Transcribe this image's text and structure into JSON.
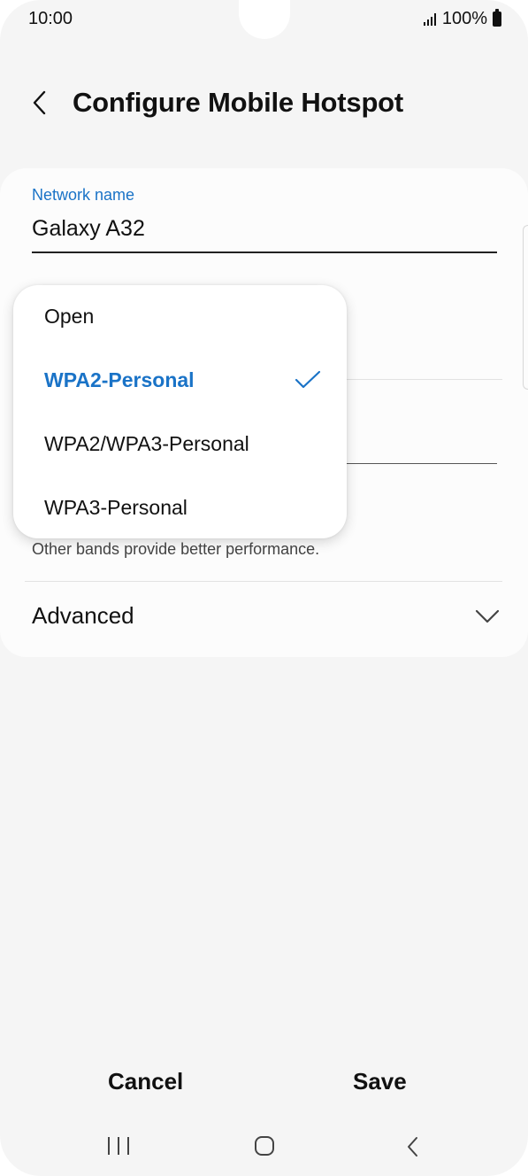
{
  "status_bar": {
    "time": "10:00",
    "battery": "100%",
    "icons": [
      "signal-icon",
      "battery-icon"
    ]
  },
  "header": {
    "title": "Configure Mobile Hotspot",
    "back_icon": "chevron-left-icon"
  },
  "form": {
    "network_name_label": "Network name",
    "network_name_value": "Galaxy A32",
    "band_note": "Other bands provide better performance.",
    "advanced_label": "Advanced",
    "advanced_icon": "chevron-down-icon"
  },
  "security_dropdown": {
    "options": [
      {
        "label": "Open",
        "selected": false
      },
      {
        "label": "WPA2-Personal",
        "selected": true
      },
      {
        "label": "WPA2/WPA3-Personal",
        "selected": false
      },
      {
        "label": "WPA3-Personal",
        "selected": false
      }
    ],
    "selected_icon": "check-icon"
  },
  "actions": {
    "cancel_label": "Cancel",
    "save_label": "Save"
  },
  "nav_bar": {
    "icons": [
      "recent-apps-icon",
      "home-icon",
      "back-icon"
    ]
  },
  "colors": {
    "accent": "#1a73c7",
    "background": "#f5f5f5",
    "card": "#fcfcfc"
  }
}
